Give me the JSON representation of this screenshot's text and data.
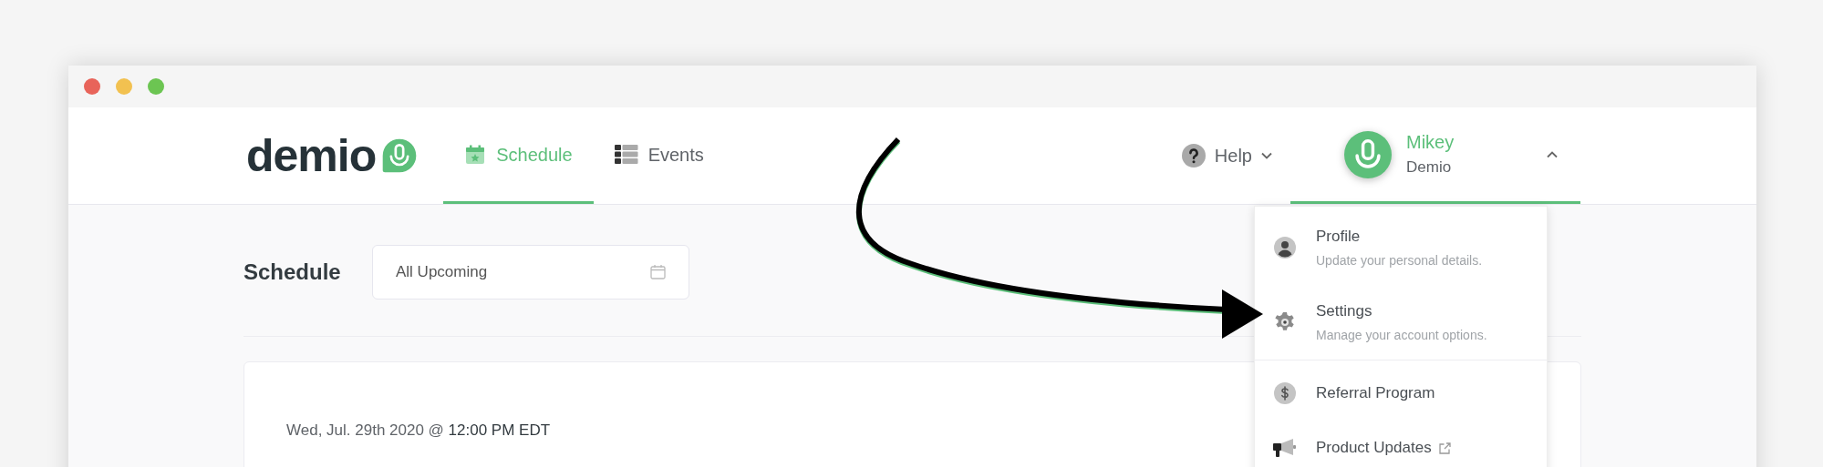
{
  "window": {
    "controls": [
      {
        "color": "#e8645a"
      },
      {
        "color": "#f2c150"
      },
      {
        "color": "#6cc552"
      }
    ]
  },
  "header": {
    "logo": "demio",
    "tabs": [
      {
        "label": "Schedule",
        "selected": true,
        "kind": "schedule"
      },
      {
        "label": "Events",
        "selected": false,
        "kind": "events"
      }
    ],
    "help": {
      "label": "Help"
    },
    "user": {
      "name": "Mikey",
      "org": "Demio",
      "expanded": true
    }
  },
  "page": {
    "title": "Schedule",
    "filter": {
      "value": "All Upcoming"
    },
    "event": {
      "date": "Wed, Jul. 29th 2020 @ **12:00 PM EDT**"
    }
  },
  "menu": {
    "sections": [
      [
        {
          "kind": "profile",
          "title": "Profile",
          "subtitle": "Update your personal details."
        },
        {
          "kind": "settings",
          "title": "Settings",
          "subtitle": "Manage your account options."
        }
      ],
      [
        {
          "kind": "referral",
          "title": "Referral Program",
          "external": false
        },
        {
          "kind": "updates",
          "title": "Product Updates",
          "external": true
        }
      ]
    ]
  }
}
